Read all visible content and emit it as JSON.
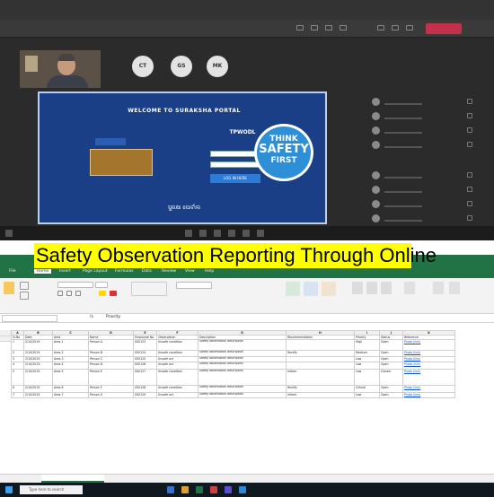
{
  "caption": "Safety Observation Reporting Through Online",
  "meeting": {
    "participants": [
      {
        "initials": "CT"
      },
      {
        "initials": "GS"
      },
      {
        "initials": "MK"
      }
    ],
    "portal": {
      "heading": "WELCOME TO SURAKSHA PORTAL",
      "login_title": "TPWODL",
      "login_button": "LOG IN HERE",
      "footer": "ସୁରକ୍ଷା ପୋର୍ଟାଲ"
    },
    "safety_badge": {
      "line1": "THINK",
      "line2": "SAFETY",
      "line3": "FIRST"
    }
  },
  "excel": {
    "menus": [
      "File",
      "Home",
      "Insert",
      "Page Layout",
      "Formulas",
      "Data",
      "Review",
      "View",
      "Help"
    ],
    "formula_bar": {
      "fx": "fx",
      "value": "Priority"
    },
    "columns": [
      "A",
      "B",
      "C",
      "D",
      "E",
      "F",
      "G",
      "H",
      "I",
      "J",
      "K"
    ],
    "table_headers": [
      "Sl.No",
      "Date",
      "Area",
      "Name",
      "Employee No.",
      "Observation",
      "Description",
      "Recommendation",
      "Priority",
      "Status",
      "Reference"
    ],
    "rows": [
      [
        "1",
        "2/10/2019",
        "Area-1",
        "Person A",
        "000123",
        "Unsafe condition",
        "Safety observation description",
        "",
        "High",
        "Open",
        "Photo (link)"
      ],
      [
        "2",
        "2/10/2019",
        "Area-2",
        "Person B",
        "000124",
        "Unsafe condition",
        "Safety observation description",
        "Rectify",
        "Medium",
        "Open",
        "Photo (link)"
      ],
      [
        "3",
        "2/10/2019",
        "Area-3",
        "Person C",
        "000125",
        "Unsafe act",
        "Safety observation description",
        "",
        "Low",
        "Open",
        "Photo (link)"
      ],
      [
        "4",
        "2/10/2019",
        "Area-4",
        "Person D",
        "000126",
        "Unsafe act",
        "Safety observation description",
        "",
        "Low",
        "Open",
        "Photo (link)"
      ],
      [
        "5",
        "2/10/2019",
        "Area-5",
        "Person E",
        "000127",
        "Unsafe condition",
        "Safety observation description",
        "Inform",
        "Low",
        "Closed",
        "Photo (link)"
      ],
      [
        "6",
        "2/10/2019",
        "Area-6",
        "Person F",
        "000128",
        "Unsafe condition",
        "Safety observation description",
        "Rectify",
        "Critical",
        "Open",
        "Photo (link)"
      ],
      [
        "7",
        "2/10/2019",
        "Area-7",
        "Person G",
        "000129",
        "Unsafe act",
        "Safety observation description",
        "Inform",
        "Low",
        "Open",
        "Photo (link)"
      ]
    ],
    "taskbar": {
      "search": "Type here to search"
    }
  }
}
